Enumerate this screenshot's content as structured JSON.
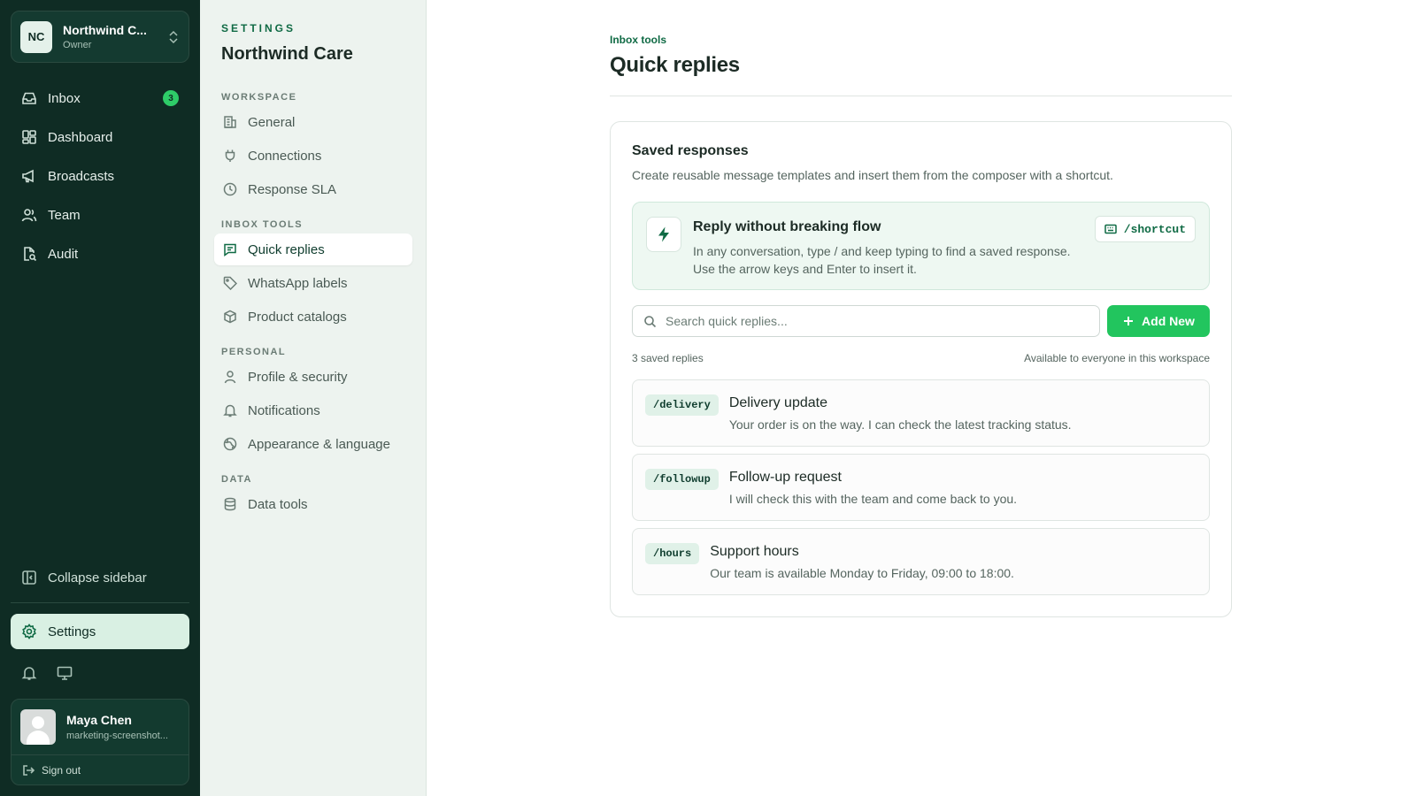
{
  "org": {
    "initials": "NC",
    "name": "Northwind C...",
    "role": "Owner"
  },
  "nav": {
    "items": [
      {
        "label": "Inbox",
        "badge": "3",
        "icon": "inbox-icon"
      },
      {
        "label": "Dashboard",
        "icon": "dashboard-icon"
      },
      {
        "label": "Broadcasts",
        "icon": "megaphone-icon"
      },
      {
        "label": "Team",
        "icon": "team-icon"
      },
      {
        "label": "Audit",
        "icon": "audit-icon"
      }
    ],
    "collapse_label": "Collapse sidebar",
    "settings_label": "Settings"
  },
  "user": {
    "name": "Maya Chen",
    "email": "marketing-screenshot...",
    "signout_label": "Sign out"
  },
  "settings_panel": {
    "kicker": "SETTINGS",
    "title": "Northwind Care",
    "sections": [
      {
        "label": "WORKSPACE",
        "items": [
          {
            "label": "General",
            "icon": "building-icon"
          },
          {
            "label": "Connections",
            "icon": "plug-icon"
          },
          {
            "label": "Response SLA",
            "icon": "clock-icon"
          }
        ]
      },
      {
        "label": "INBOX TOOLS",
        "items": [
          {
            "label": "Quick replies",
            "icon": "message-icon",
            "active": true
          },
          {
            "label": "WhatsApp labels",
            "icon": "tag-icon"
          },
          {
            "label": "Product catalogs",
            "icon": "box-icon"
          }
        ]
      },
      {
        "label": "PERSONAL",
        "items": [
          {
            "label": "Profile & security",
            "icon": "user-icon"
          },
          {
            "label": "Notifications",
            "icon": "bell-icon"
          },
          {
            "label": "Appearance & language",
            "icon": "globe-icon"
          }
        ]
      },
      {
        "label": "DATA",
        "items": [
          {
            "label": "Data tools",
            "icon": "database-icon"
          }
        ]
      }
    ]
  },
  "main": {
    "breadcrumb": "Inbox tools",
    "title": "Quick replies",
    "card": {
      "title": "Saved responses",
      "description": "Create reusable message templates and insert them from the composer with a shortcut.",
      "tip": {
        "title": "Reply without breaking flow",
        "text": "In any conversation, type / and keep typing to find a saved response. Use the arrow keys and Enter to insert it.",
        "shortcut": "/shortcut"
      },
      "search_placeholder": "Search quick replies...",
      "add_label": "Add New",
      "count_label": "3 saved replies",
      "visibility_label": "Available to everyone in this workspace",
      "replies": [
        {
          "code": "/delivery",
          "title": "Delivery update",
          "body": "Your order is on the way. I can check the latest tracking status."
        },
        {
          "code": "/followup",
          "title": "Follow-up request",
          "body": "I will check this with the team and come back to you."
        },
        {
          "code": "/hours",
          "title": "Support hours",
          "body": "Our team is available Monday to Friday, 09:00 to 18:00."
        }
      ]
    }
  },
  "colors": {
    "sidebar": "#0f2c24",
    "accent": "#22c55e",
    "brand_text": "#0f6a44"
  }
}
